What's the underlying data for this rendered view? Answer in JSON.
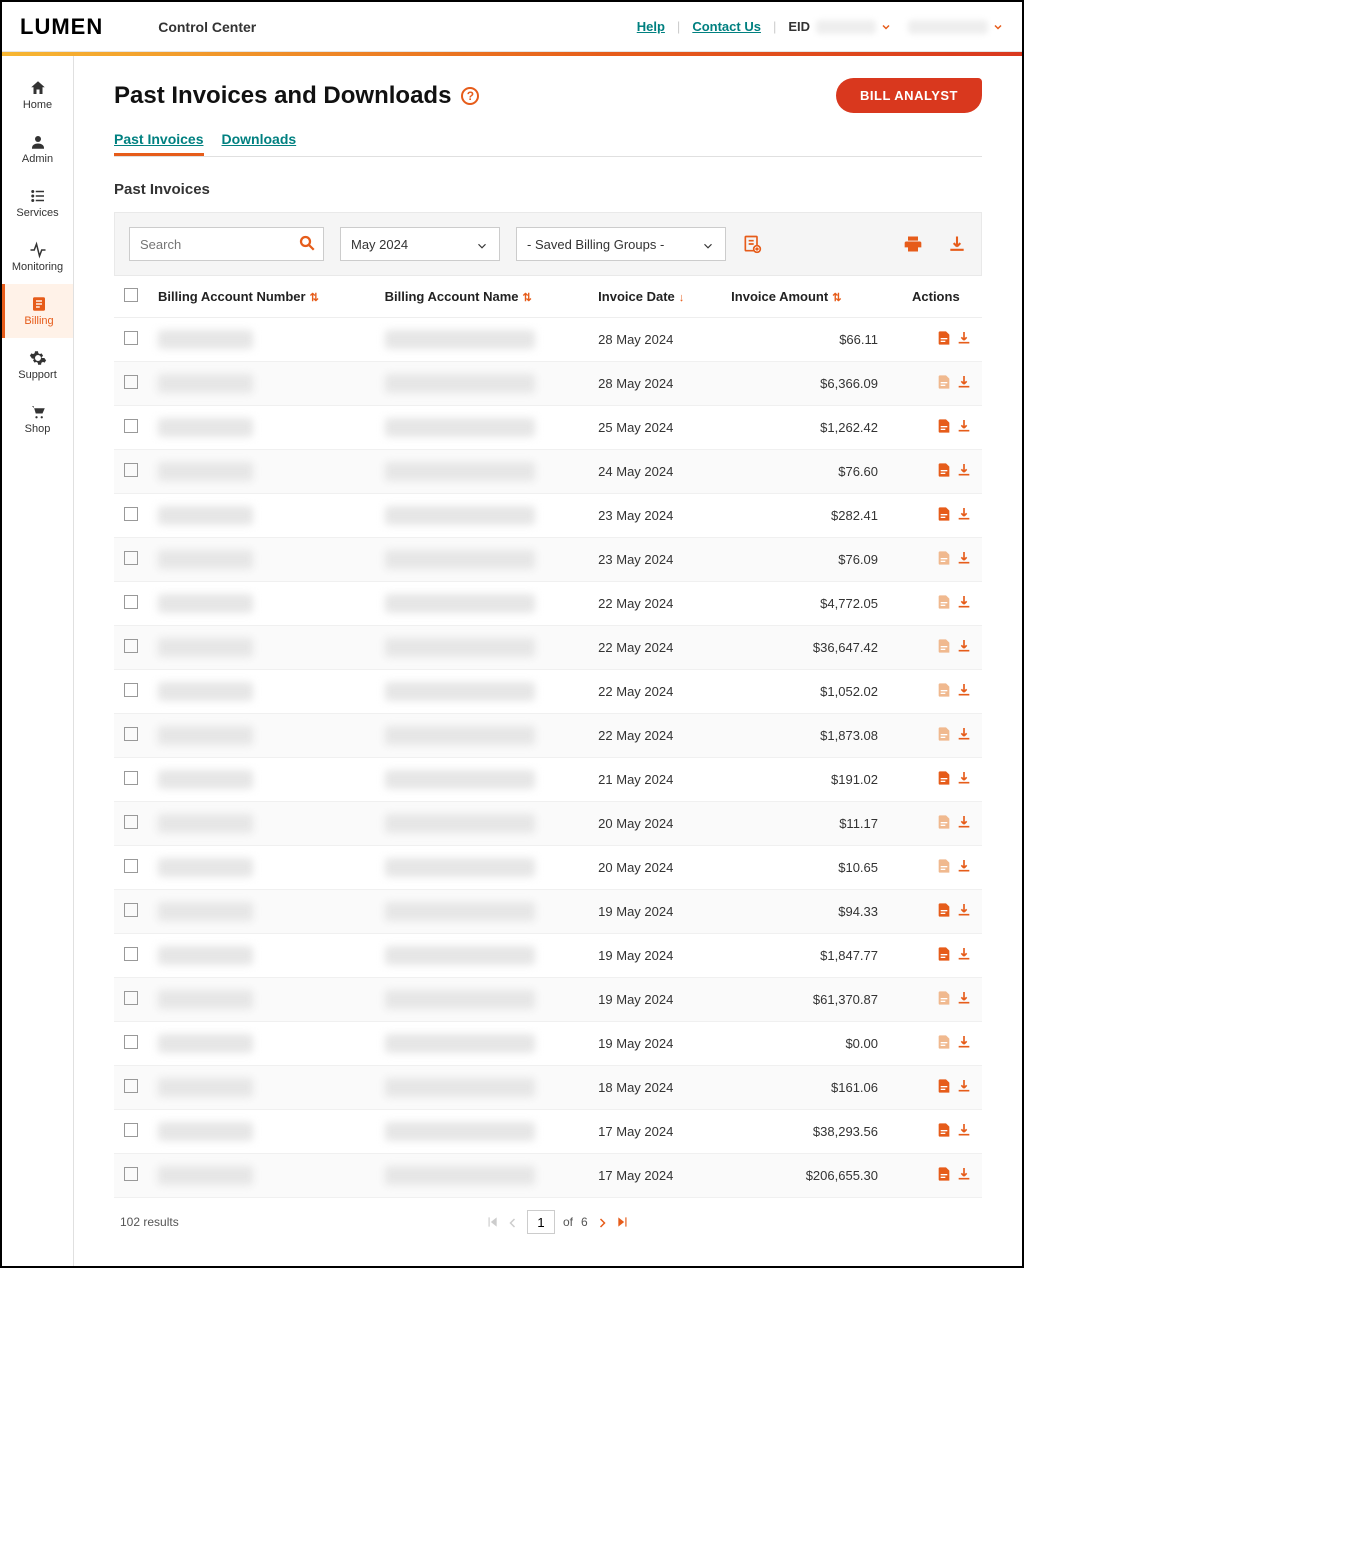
{
  "brand": "LUMEN",
  "app_title": "Control Center",
  "top_links": {
    "help": "Help",
    "contact": "Contact Us"
  },
  "eid_label": "EID",
  "eid_value_mask": "XXXXXXX",
  "user_mask": "XXXXXXXXX",
  "sidebar": {
    "items": [
      {
        "label": "Home",
        "icon": "home"
      },
      {
        "label": "Admin",
        "icon": "user"
      },
      {
        "label": "Services",
        "icon": "list"
      },
      {
        "label": "Monitoring",
        "icon": "activity"
      },
      {
        "label": "Billing",
        "icon": "billing",
        "active": true
      },
      {
        "label": "Support",
        "icon": "gear"
      },
      {
        "label": "Shop",
        "icon": "cart"
      }
    ]
  },
  "page": {
    "title": "Past Invoices and Downloads",
    "bill_analyst": "BILL ANALYST",
    "tabs": [
      "Past Invoices",
      "Downloads"
    ],
    "section_title": "Past Invoices",
    "search_placeholder": "Search",
    "month_value": "May 2024",
    "group_value": "- Saved Billing Groups -"
  },
  "columns": {
    "acct_num": "Billing Account Number",
    "acct_name": "Billing Account Name",
    "date": "Invoice Date",
    "amount": "Invoice Amount",
    "actions": "Actions"
  },
  "rows": [
    {
      "date": "28 May 2024",
      "amount": "$66.11",
      "pdf_dim": false
    },
    {
      "date": "28 May 2024",
      "amount": "$6,366.09",
      "pdf_dim": true
    },
    {
      "date": "25 May 2024",
      "amount": "$1,262.42",
      "pdf_dim": false
    },
    {
      "date": "24 May 2024",
      "amount": "$76.60",
      "pdf_dim": false
    },
    {
      "date": "23 May 2024",
      "amount": "$282.41",
      "pdf_dim": false
    },
    {
      "date": "23 May 2024",
      "amount": "$76.09",
      "pdf_dim": true
    },
    {
      "date": "22 May 2024",
      "amount": "$4,772.05",
      "pdf_dim": true
    },
    {
      "date": "22 May 2024",
      "amount": "$36,647.42",
      "pdf_dim": true
    },
    {
      "date": "22 May 2024",
      "amount": "$1,052.02",
      "pdf_dim": true
    },
    {
      "date": "22 May 2024",
      "amount": "$1,873.08",
      "pdf_dim": true
    },
    {
      "date": "21 May 2024",
      "amount": "$191.02",
      "pdf_dim": false
    },
    {
      "date": "20 May 2024",
      "amount": "$11.17",
      "pdf_dim": true
    },
    {
      "date": "20 May 2024",
      "amount": "$10.65",
      "pdf_dim": true
    },
    {
      "date": "19 May 2024",
      "amount": "$94.33",
      "pdf_dim": false
    },
    {
      "date": "19 May 2024",
      "amount": "$1,847.77",
      "pdf_dim": false
    },
    {
      "date": "19 May 2024",
      "amount": "$61,370.87",
      "pdf_dim": true
    },
    {
      "date": "19 May 2024",
      "amount": "$0.00",
      "pdf_dim": true
    },
    {
      "date": "18 May 2024",
      "amount": "$161.06",
      "pdf_dim": false
    },
    {
      "date": "17 May 2024",
      "amount": "$38,293.56",
      "pdf_dim": false
    },
    {
      "date": "17 May 2024",
      "amount": "$206,655.30",
      "pdf_dim": false
    }
  ],
  "pager": {
    "results_text": "102 results",
    "page": "1",
    "of_label": "of",
    "total": "6"
  }
}
